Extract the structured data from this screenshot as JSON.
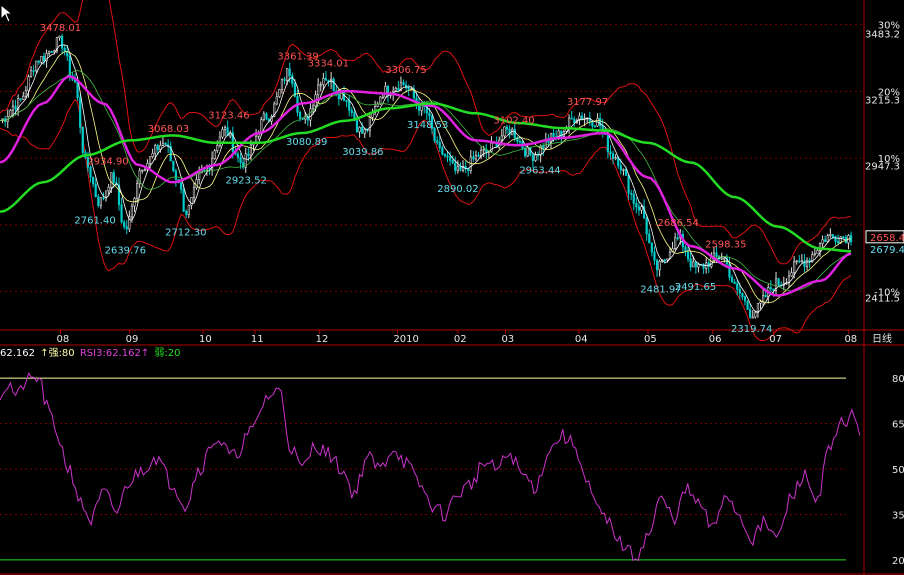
{
  "colors": {
    "background": "#000000",
    "frame": "#b00000",
    "grid": "#7a0000",
    "ma_long": "#22dd22",
    "ma_mid": "#e020e0",
    "ma_short": "#ffff88",
    "ma_fast": "#ffffff",
    "ma_green_thin": "#44bb44",
    "boll": "#dd1111",
    "candle_up": "#e0e0e0",
    "candle_down": "#00cccc",
    "price_label_high": "#ff5555",
    "price_label_low": "#66ddee",
    "axis_text": "#e8e8e8",
    "rsi_line": "#cc33cc",
    "rsi_strong": "#ffffaa",
    "rsi_weak": "#22dd22",
    "current_box": "#ffffff"
  },
  "chart_data": [
    {
      "type": "candlestick",
      "period_label": "日线",
      "y_axis_labels": [
        {
          "label": "30%",
          "value": 3520
        },
        {
          "label": "3483.2",
          "value": 3483.2
        },
        {
          "label": "20%",
          "value": 3249
        },
        {
          "label": "3215.3",
          "value": 3215.3
        },
        {
          "label": "10%",
          "value": 2978
        },
        {
          "label": "2947.3",
          "value": 2947.3
        },
        {
          "label": "-10%",
          "value": 2437
        },
        {
          "label": "2411.5",
          "value": 2411.5
        }
      ],
      "ylim": [
        2280,
        3620
      ],
      "current_price": "2658.4",
      "current_value": 2658.4,
      "current_price_alt": "2679.4",
      "x_ticks": [
        {
          "label": "08",
          "t": 0.07
        },
        {
          "label": "09",
          "t": 0.15
        },
        {
          "label": "10",
          "t": 0.235
        },
        {
          "label": "11",
          "t": 0.295
        },
        {
          "label": "12",
          "t": 0.37
        },
        {
          "label": "2010",
          "t": 0.46
        },
        {
          "label": "02",
          "t": 0.53
        },
        {
          "label": "03",
          "t": 0.585
        },
        {
          "label": "04",
          "t": 0.67
        },
        {
          "label": "05",
          "t": 0.75
        },
        {
          "label": "06",
          "t": 0.825
        },
        {
          "label": "07",
          "t": 0.895
        },
        {
          "label": "08",
          "t": 0.982
        }
      ],
      "annotations": [
        {
          "text": "3478.01",
          "t": 0.07,
          "value": 3478.01,
          "kind": "high"
        },
        {
          "text": "2761.40",
          "t": 0.11,
          "value": 2761.4,
          "kind": "low"
        },
        {
          "text": "2639.76",
          "t": 0.145,
          "value": 2639.76,
          "kind": "low"
        },
        {
          "text": "2934.90",
          "t": 0.125,
          "value": 2934.9,
          "kind": "high"
        },
        {
          "text": "3068.03",
          "t": 0.195,
          "value": 3068.03,
          "kind": "high"
        },
        {
          "text": "2712.30",
          "t": 0.215,
          "value": 2712.3,
          "kind": "low"
        },
        {
          "text": "3123.46",
          "t": 0.265,
          "value": 3123.46,
          "kind": "high"
        },
        {
          "text": "2923.52",
          "t": 0.285,
          "value": 2923.52,
          "kind": "low"
        },
        {
          "text": "3361.39",
          "t": 0.345,
          "value": 3361.39,
          "kind": "high"
        },
        {
          "text": "3080.89",
          "t": 0.355,
          "value": 3080.89,
          "kind": "low"
        },
        {
          "text": "3334.01",
          "t": 0.38,
          "value": 3334.01,
          "kind": "high"
        },
        {
          "text": "3039.86",
          "t": 0.42,
          "value": 3039.86,
          "kind": "low"
        },
        {
          "text": "3306.75",
          "t": 0.47,
          "value": 3306.75,
          "kind": "high"
        },
        {
          "text": "3148.53",
          "t": 0.495,
          "value": 3148.53,
          "kind": "low"
        },
        {
          "text": "2890.02",
          "t": 0.53,
          "value": 2890.02,
          "kind": "low"
        },
        {
          "text": "3102.40",
          "t": 0.595,
          "value": 3102.4,
          "kind": "high"
        },
        {
          "text": "2963.44",
          "t": 0.625,
          "value": 2963.44,
          "kind": "low"
        },
        {
          "text": "3177.97",
          "t": 0.68,
          "value": 3177.97,
          "kind": "high"
        },
        {
          "text": "2686.54",
          "t": 0.785,
          "value": 2686.54,
          "kind": "high"
        },
        {
          "text": "2481.97",
          "t": 0.765,
          "value": 2481.97,
          "kind": "low"
        },
        {
          "text": "2491.65",
          "t": 0.805,
          "value": 2491.65,
          "kind": "low"
        },
        {
          "text": "2598.35",
          "t": 0.84,
          "value": 2598.35,
          "kind": "high"
        },
        {
          "text": "2319.74",
          "t": 0.87,
          "value": 2319.74,
          "kind": "low"
        }
      ],
      "anchors": [
        {
          "t": 0.0,
          "v": 3130
        },
        {
          "t": 0.02,
          "v": 3200
        },
        {
          "t": 0.045,
          "v": 3380
        },
        {
          "t": 0.07,
          "v": 3450
        },
        {
          "t": 0.085,
          "v": 3300
        },
        {
          "t": 0.1,
          "v": 2950
        },
        {
          "t": 0.115,
          "v": 2800
        },
        {
          "t": 0.13,
          "v": 2900
        },
        {
          "t": 0.145,
          "v": 2690
        },
        {
          "t": 0.165,
          "v": 2950
        },
        {
          "t": 0.19,
          "v": 3040
        },
        {
          "t": 0.205,
          "v": 2900
        },
        {
          "t": 0.215,
          "v": 2760
        },
        {
          "t": 0.235,
          "v": 2920
        },
        {
          "t": 0.26,
          "v": 3090
        },
        {
          "t": 0.28,
          "v": 2960
        },
        {
          "t": 0.31,
          "v": 3150
        },
        {
          "t": 0.335,
          "v": 3330
        },
        {
          "t": 0.35,
          "v": 3120
        },
        {
          "t": 0.375,
          "v": 3310
        },
        {
          "t": 0.395,
          "v": 3240
        },
        {
          "t": 0.42,
          "v": 3080
        },
        {
          "t": 0.445,
          "v": 3250
        },
        {
          "t": 0.465,
          "v": 3280
        },
        {
          "t": 0.49,
          "v": 3180
        },
        {
          "t": 0.51,
          "v": 3000
        },
        {
          "t": 0.53,
          "v": 2920
        },
        {
          "t": 0.56,
          "v": 3000
        },
        {
          "t": 0.59,
          "v": 3090
        },
        {
          "t": 0.615,
          "v": 2990
        },
        {
          "t": 0.64,
          "v": 3060
        },
        {
          "t": 0.67,
          "v": 3150
        },
        {
          "t": 0.69,
          "v": 3130
        },
        {
          "t": 0.71,
          "v": 2990
        },
        {
          "t": 0.74,
          "v": 2780
        },
        {
          "t": 0.76,
          "v": 2530
        },
        {
          "t": 0.785,
          "v": 2650
        },
        {
          "t": 0.805,
          "v": 2530
        },
        {
          "t": 0.835,
          "v": 2580
        },
        {
          "t": 0.855,
          "v": 2430
        },
        {
          "t": 0.87,
          "v": 2350
        },
        {
          "t": 0.9,
          "v": 2470
        },
        {
          "t": 0.93,
          "v": 2560
        },
        {
          "t": 0.96,
          "v": 2660
        },
        {
          "t": 0.985,
          "v": 2658
        }
      ],
      "ma_long_anchors": [
        {
          "t": 0.0,
          "v": 2760
        },
        {
          "t": 0.05,
          "v": 2880
        },
        {
          "t": 0.1,
          "v": 2990
        },
        {
          "t": 0.15,
          "v": 3050
        },
        {
          "t": 0.2,
          "v": 3070
        },
        {
          "t": 0.25,
          "v": 3040
        },
        {
          "t": 0.3,
          "v": 3040
        },
        {
          "t": 0.35,
          "v": 3080
        },
        {
          "t": 0.4,
          "v": 3130
        },
        {
          "t": 0.45,
          "v": 3180
        },
        {
          "t": 0.5,
          "v": 3200
        },
        {
          "t": 0.55,
          "v": 3160
        },
        {
          "t": 0.6,
          "v": 3120
        },
        {
          "t": 0.65,
          "v": 3100
        },
        {
          "t": 0.7,
          "v": 3090
        },
        {
          "t": 0.75,
          "v": 3040
        },
        {
          "t": 0.8,
          "v": 2960
        },
        {
          "t": 0.85,
          "v": 2820
        },
        {
          "t": 0.9,
          "v": 2700
        },
        {
          "t": 0.95,
          "v": 2610
        },
        {
          "t": 0.985,
          "v": 2600
        }
      ],
      "ma_mid_anchors": [
        {
          "t": 0.0,
          "v": 2960
        },
        {
          "t": 0.05,
          "v": 3200
        },
        {
          "t": 0.08,
          "v": 3310
        },
        {
          "t": 0.12,
          "v": 3200
        },
        {
          "t": 0.16,
          "v": 2950
        },
        {
          "t": 0.2,
          "v": 2880
        },
        {
          "t": 0.25,
          "v": 2950
        },
        {
          "t": 0.3,
          "v": 3080
        },
        {
          "t": 0.35,
          "v": 3200
        },
        {
          "t": 0.4,
          "v": 3250
        },
        {
          "t": 0.45,
          "v": 3240
        },
        {
          "t": 0.5,
          "v": 3190
        },
        {
          "t": 0.55,
          "v": 3050
        },
        {
          "t": 0.6,
          "v": 3030
        },
        {
          "t": 0.65,
          "v": 3060
        },
        {
          "t": 0.7,
          "v": 3080
        },
        {
          "t": 0.75,
          "v": 2900
        },
        {
          "t": 0.8,
          "v": 2620
        },
        {
          "t": 0.85,
          "v": 2530
        },
        {
          "t": 0.9,
          "v": 2420
        },
        {
          "t": 0.95,
          "v": 2480
        },
        {
          "t": 0.985,
          "v": 2590
        }
      ]
    },
    {
      "type": "line",
      "indicator": "RSI",
      "legend": [
        {
          "text": "62.162",
          "role": "rsi-partial"
        },
        {
          "text": "↑强:80",
          "role": "strong"
        },
        {
          "text": "RSI3:62.162↑",
          "role": "rsi3"
        },
        {
          "text": "弱:20",
          "role": "weak"
        }
      ],
      "y_tick_labels": [
        "80",
        "65",
        "50",
        "35",
        "20"
      ],
      "y_tick_values": [
        80,
        65,
        50,
        35,
        20
      ],
      "ylim": [
        16,
        86
      ],
      "anchors": [
        {
          "t": 0.0,
          "v": 75
        },
        {
          "t": 0.01,
          "v": 78
        },
        {
          "t": 0.02,
          "v": 74
        },
        {
          "t": 0.03,
          "v": 79
        },
        {
          "t": 0.045,
          "v": 80
        },
        {
          "t": 0.055,
          "v": 70
        },
        {
          "t": 0.065,
          "v": 62
        },
        {
          "t": 0.08,
          "v": 50
        },
        {
          "t": 0.095,
          "v": 38
        },
        {
          "t": 0.105,
          "v": 33
        },
        {
          "t": 0.12,
          "v": 42
        },
        {
          "t": 0.135,
          "v": 36
        },
        {
          "t": 0.15,
          "v": 46
        },
        {
          "t": 0.165,
          "v": 50
        },
        {
          "t": 0.18,
          "v": 54
        },
        {
          "t": 0.2,
          "v": 45
        },
        {
          "t": 0.215,
          "v": 38
        },
        {
          "t": 0.23,
          "v": 50
        },
        {
          "t": 0.25,
          "v": 60
        },
        {
          "t": 0.27,
          "v": 54
        },
        {
          "t": 0.29,
          "v": 62
        },
        {
          "t": 0.31,
          "v": 74
        },
        {
          "t": 0.325,
          "v": 76
        },
        {
          "t": 0.335,
          "v": 58
        },
        {
          "t": 0.35,
          "v": 50
        },
        {
          "t": 0.365,
          "v": 58
        },
        {
          "t": 0.38,
          "v": 55
        },
        {
          "t": 0.395,
          "v": 50
        },
        {
          "t": 0.41,
          "v": 42
        },
        {
          "t": 0.425,
          "v": 54
        },
        {
          "t": 0.44,
          "v": 50
        },
        {
          "t": 0.455,
          "v": 57
        },
        {
          "t": 0.47,
          "v": 52
        },
        {
          "t": 0.485,
          "v": 45
        },
        {
          "t": 0.5,
          "v": 38
        },
        {
          "t": 0.515,
          "v": 35
        },
        {
          "t": 0.53,
          "v": 42
        },
        {
          "t": 0.545,
          "v": 45
        },
        {
          "t": 0.56,
          "v": 52
        },
        {
          "t": 0.575,
          "v": 50
        },
        {
          "t": 0.59,
          "v": 55
        },
        {
          "t": 0.605,
          "v": 48
        },
        {
          "t": 0.62,
          "v": 44
        },
        {
          "t": 0.635,
          "v": 56
        },
        {
          "t": 0.65,
          "v": 61
        },
        {
          "t": 0.665,
          "v": 58
        },
        {
          "t": 0.68,
          "v": 45
        },
        {
          "t": 0.69,
          "v": 37
        },
        {
          "t": 0.705,
          "v": 32
        },
        {
          "t": 0.72,
          "v": 25
        },
        {
          "t": 0.735,
          "v": 21
        },
        {
          "t": 0.75,
          "v": 28
        },
        {
          "t": 0.765,
          "v": 40
        },
        {
          "t": 0.78,
          "v": 34
        },
        {
          "t": 0.795,
          "v": 43
        },
        {
          "t": 0.81,
          "v": 38
        },
        {
          "t": 0.825,
          "v": 30
        },
        {
          "t": 0.84,
          "v": 42
        },
        {
          "t": 0.855,
          "v": 35
        },
        {
          "t": 0.87,
          "v": 27
        },
        {
          "t": 0.885,
          "v": 32
        },
        {
          "t": 0.9,
          "v": 27
        },
        {
          "t": 0.915,
          "v": 40
        },
        {
          "t": 0.93,
          "v": 48
        },
        {
          "t": 0.945,
          "v": 40
        },
        {
          "t": 0.96,
          "v": 56
        },
        {
          "t": 0.975,
          "v": 65
        },
        {
          "t": 0.985,
          "v": 68
        },
        {
          "t": 0.995,
          "v": 62
        }
      ]
    }
  ]
}
